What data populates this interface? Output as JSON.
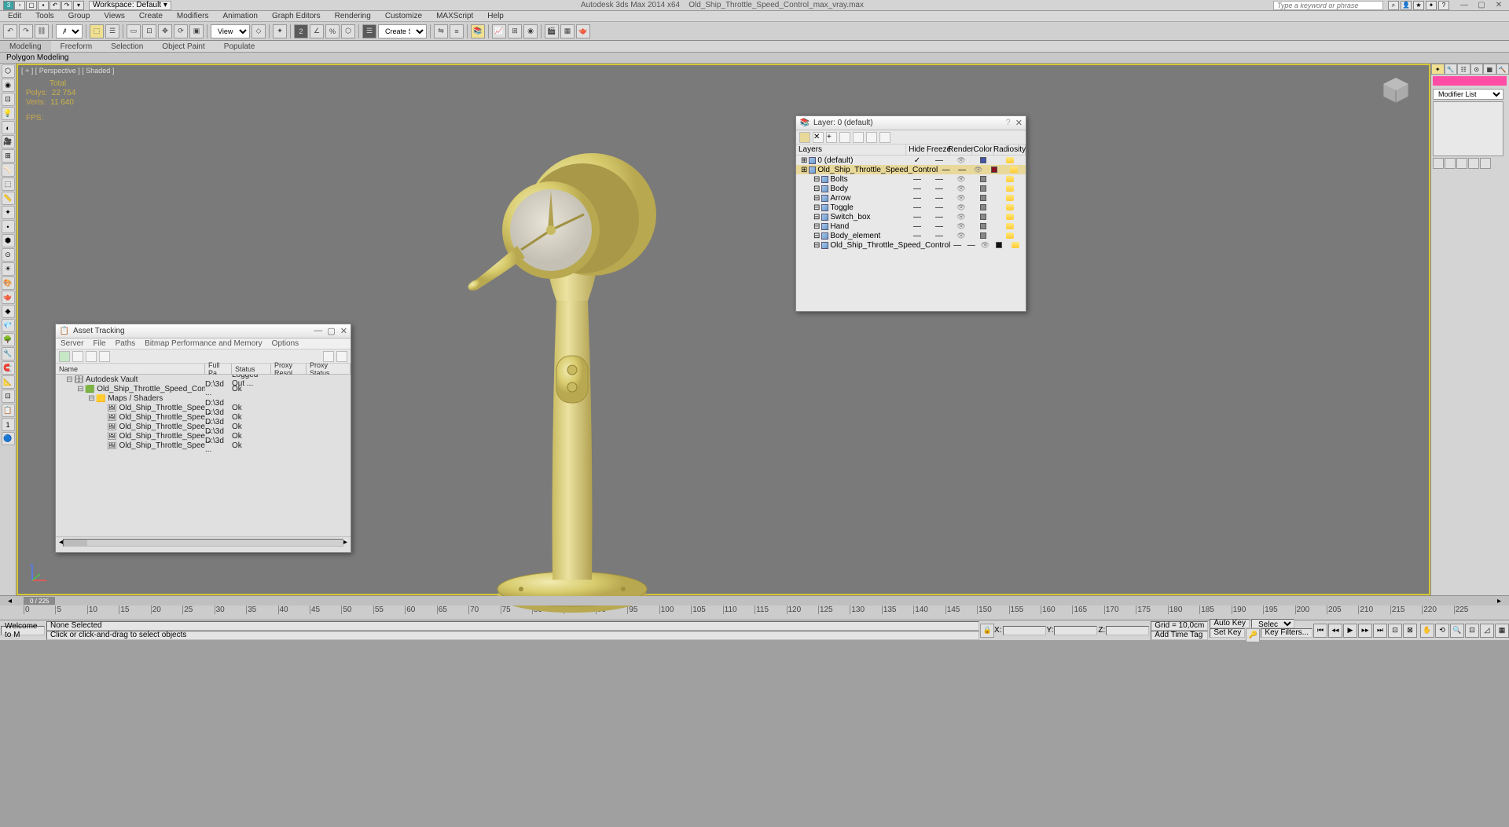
{
  "title": {
    "app": "Autodesk 3ds Max  2014 x64",
    "file": "Old_Ship_Throttle_Speed_Control_max_vray.max",
    "workspace_label": "Workspace: Default",
    "search_placeholder": "Type a keyword or phrase"
  },
  "menu": [
    "Edit",
    "Tools",
    "Group",
    "Views",
    "Create",
    "Modifiers",
    "Animation",
    "Graph Editors",
    "Rendering",
    "Customize",
    "MAXScript",
    "Help"
  ],
  "topbar": {
    "all": "All",
    "view": "View",
    "create_sel": "Create Selection Se"
  },
  "ribbon": [
    "Modeling",
    "Freeform",
    "Selection",
    "Object Paint",
    "Populate"
  ],
  "subribbon": "Polygon Modeling",
  "viewport": {
    "label": "[ + ] [ Perspective ] [ Shaded ]",
    "stats_total": "Total",
    "stats_polys_lbl": "Polys:",
    "stats_polys": "22 754",
    "stats_verts_lbl": "Verts:",
    "stats_verts": "11 640",
    "stats_fps": "FPS:"
  },
  "right_panel": {
    "modlist": "Modifier List"
  },
  "timeline": {
    "scrub": "0 / 225",
    "ticks": [
      "0",
      "5",
      "10",
      "15",
      "20",
      "25",
      "30",
      "35",
      "40",
      "45",
      "50",
      "55",
      "60",
      "65",
      "70",
      "75",
      "80",
      "85",
      "90",
      "95",
      "100",
      "105",
      "110",
      "115",
      "120",
      "125",
      "130",
      "135",
      "140",
      "145",
      "150",
      "155",
      "160",
      "165",
      "170",
      "175",
      "180",
      "185",
      "190",
      "195",
      "200",
      "205",
      "210",
      "215",
      "220",
      "225"
    ]
  },
  "status": {
    "welcome": "Welcome to M",
    "sel": "None Selected",
    "hint": "Click or click-and-drag to select objects",
    "x": "X:",
    "y": "Y:",
    "z": "Z:",
    "grid": "Grid = 10,0cm",
    "addtime": "Add Time Tag",
    "autokey": "Auto Key",
    "selected": "Selected",
    "setkey": "Set Key",
    "keyfilt": "Key Filters..."
  },
  "asset": {
    "title": "Asset Tracking",
    "menu": [
      "Server",
      "File",
      "Paths",
      "Bitmap Performance and Memory",
      "Options"
    ],
    "cols": [
      "Name",
      "Full Pa...",
      "Status",
      "Proxy Resol...",
      "Proxy Status"
    ],
    "rows": [
      {
        "indent": 0,
        "icon": "vault",
        "name": "Autodesk Vault",
        "path": "",
        "status": "Logged Out ..."
      },
      {
        "indent": 1,
        "icon": "max",
        "name": "Old_Ship_Throttle_Speed_Control_max_vray.max",
        "path": "D:\\3d ...",
        "status": "Ok"
      },
      {
        "indent": 2,
        "icon": "folder",
        "name": "Maps / Shaders",
        "path": "",
        "status": ""
      },
      {
        "indent": 3,
        "icon": "img",
        "name": "Old_Ship_Throttle_Speed_Control_shiny_m...",
        "path": "D:\\3d ...",
        "status": "Ok"
      },
      {
        "indent": 3,
        "icon": "img",
        "name": "Old_Ship_Throttle_Speed_Control_shiny_m...",
        "path": "D:\\3d ...",
        "status": "Ok"
      },
      {
        "indent": 3,
        "icon": "img",
        "name": "Old_Ship_Throttle_Speed_Control_shiny_m...",
        "path": "D:\\3d ...",
        "status": "Ok"
      },
      {
        "indent": 3,
        "icon": "img",
        "name": "Old_Ship_Throttle_Speed_Control_shiny_m...",
        "path": "D:\\3d ...",
        "status": "Ok"
      },
      {
        "indent": 3,
        "icon": "img",
        "name": "Old_Ship_Throttle_Speed_Control_shiny_m...",
        "path": "D:\\3d ...",
        "status": "Ok"
      }
    ]
  },
  "layer": {
    "title": "Layer: 0 (default)",
    "cols": [
      "Layers",
      "Hide",
      "Freeze",
      "Render",
      "Color",
      "Radiosity"
    ],
    "rows": [
      {
        "indent": 0,
        "name": "0 (default)",
        "sel": false,
        "hide": "✓",
        "color": "#4455aa"
      },
      {
        "indent": 0,
        "name": "Old_Ship_Throttle_Speed_Control",
        "sel": true,
        "color": "#881122"
      },
      {
        "indent": 1,
        "name": "Bolts",
        "sel": false,
        "color": "#888"
      },
      {
        "indent": 1,
        "name": "Body",
        "sel": false,
        "color": "#888"
      },
      {
        "indent": 1,
        "name": "Arrow",
        "sel": false,
        "color": "#888"
      },
      {
        "indent": 1,
        "name": "Toggle",
        "sel": false,
        "color": "#888"
      },
      {
        "indent": 1,
        "name": "Switch_box",
        "sel": false,
        "color": "#888"
      },
      {
        "indent": 1,
        "name": "Hand",
        "sel": false,
        "color": "#888"
      },
      {
        "indent": 1,
        "name": "Body_element",
        "sel": false,
        "color": "#888"
      },
      {
        "indent": 1,
        "name": "Old_Ship_Throttle_Speed_Control",
        "sel": false,
        "color": "#111"
      }
    ]
  }
}
